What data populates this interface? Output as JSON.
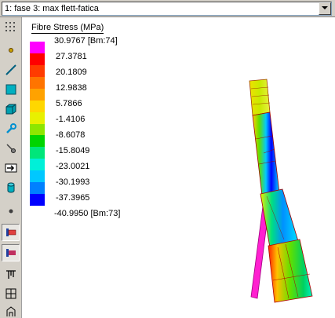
{
  "combo": {
    "value": "1: fase 3: max flett-fatica"
  },
  "toolbar": {
    "tools": [
      {
        "icon": "grid-dots-icon"
      },
      {
        "icon": "node-point-icon"
      },
      {
        "icon": "line-element-icon"
      },
      {
        "icon": "plate-element-icon"
      },
      {
        "icon": "solid-element-icon"
      },
      {
        "icon": "wrench-icon"
      },
      {
        "icon": "pin-support-icon"
      },
      {
        "icon": "arrow-load-icon"
      },
      {
        "icon": "cylinder-icon"
      },
      {
        "icon": "point-mass-icon"
      },
      {
        "icon": "beam-results-icon"
      },
      {
        "icon": "fibre-stress-icon"
      },
      {
        "icon": "hinge-icon"
      },
      {
        "icon": "table-icon"
      },
      {
        "icon": "section-icon"
      }
    ]
  },
  "legend": {
    "title": "Fibre Stress (MPa)",
    "colors": [
      "#ff00ff",
      "#ff0000",
      "#ff3b00",
      "#ff7400",
      "#ffa200",
      "#ffd700",
      "#e8f000",
      "#8ee600",
      "#00d400",
      "#00e67a",
      "#00f0d8",
      "#00c8ff",
      "#0080ff",
      "#0000ff"
    ],
    "labels": [
      "30.9767 [Bm:74]",
      "27.3781",
      "20.1809",
      "12.9838",
      "5.7866",
      "-1.4106",
      "-8.6078",
      "-15.8049",
      "-23.0021",
      "-30.1993",
      "-37.3965",
      "-40.9950 [Bm:73]"
    ]
  }
}
